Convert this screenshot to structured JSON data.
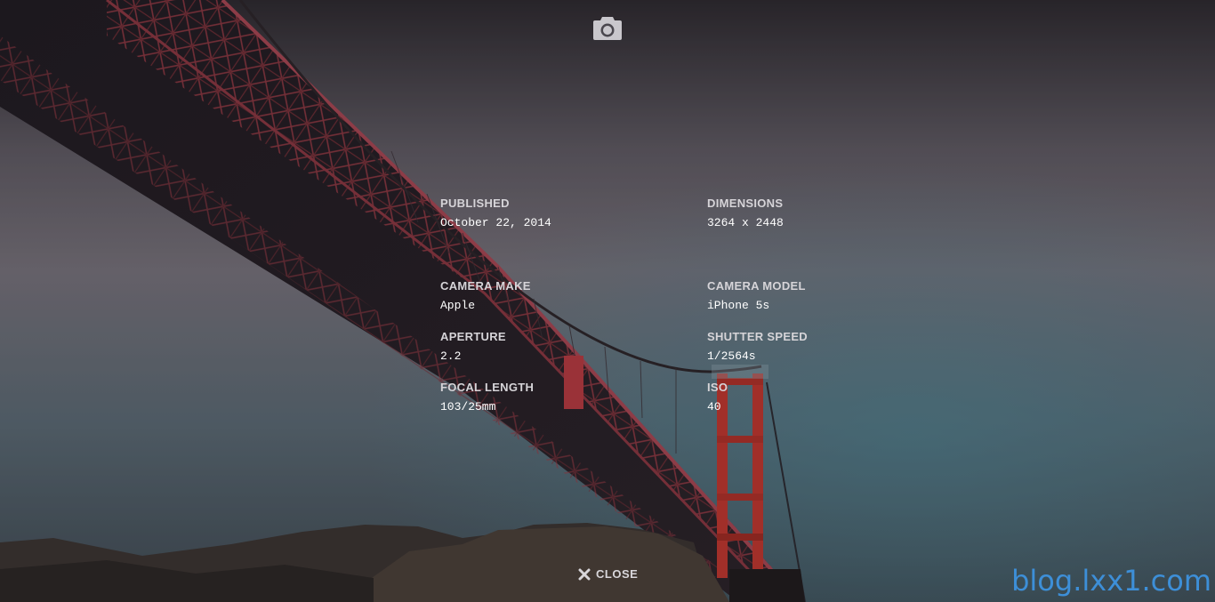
{
  "header": {
    "icon": "camera-icon"
  },
  "metadata": {
    "published": {
      "label": "PUBLISHED",
      "value": "October 22, 2014"
    },
    "dimensions": {
      "label": "DIMENSIONS",
      "value": "3264 x 2448"
    },
    "camera_make": {
      "label": "CAMERA MAKE",
      "value": "Apple"
    },
    "camera_model": {
      "label": "CAMERA MODEL",
      "value": "iPhone 5s"
    },
    "aperture": {
      "label": "APERTURE",
      "value": "2.2"
    },
    "shutter_speed": {
      "label": "SHUTTER SPEED",
      "value": "1/2564s"
    },
    "focal_length": {
      "label": "FOCAL LENGTH",
      "value": "103/25mm"
    },
    "iso": {
      "label": "ISO",
      "value": "40"
    }
  },
  "footer": {
    "close_label": "CLOSE",
    "close_icon": "close-icon"
  },
  "watermark": {
    "text": "blog.lxx1.com"
  },
  "colors": {
    "label": "#d6d4d8",
    "value": "#ffffff",
    "watermark": "#3d8fd8",
    "bridge": "#a04048",
    "tower": "#c0362e"
  }
}
